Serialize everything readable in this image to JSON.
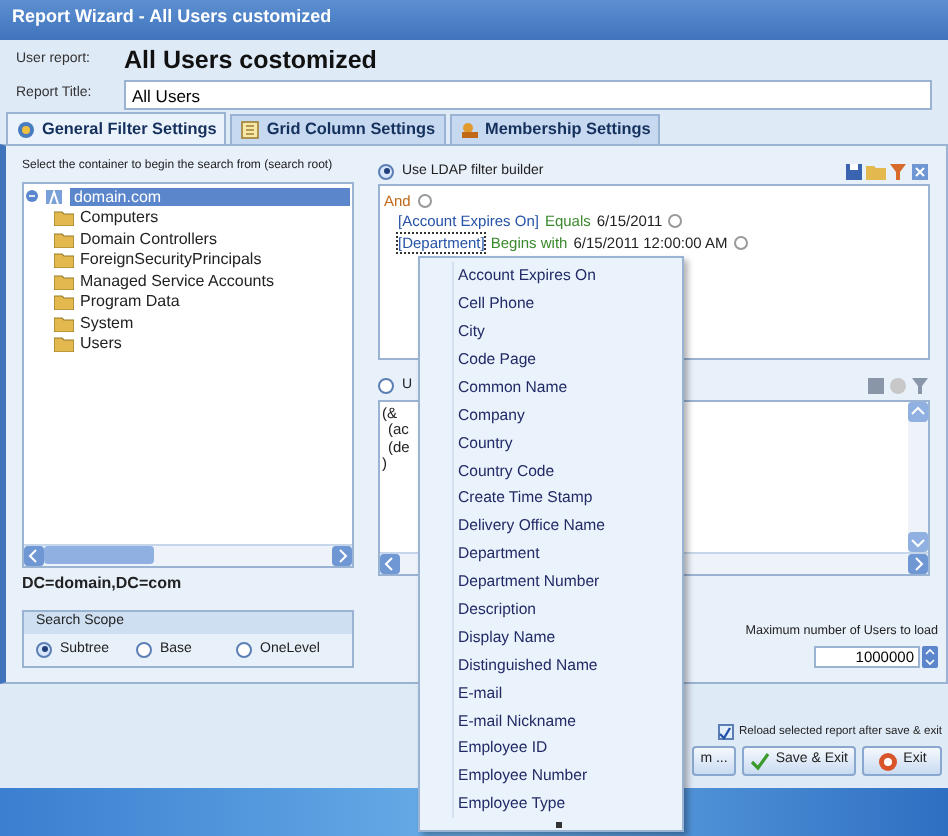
{
  "window": {
    "title": "Report Wizard - All Users customized"
  },
  "report": {
    "user_report_label": "User report:",
    "user_report": "All Users costomized",
    "title_label": "Report Title:",
    "title_value": "All Users"
  },
  "tabs": [
    {
      "label": "General Filter Settings",
      "selected": true,
      "kind": "general"
    },
    {
      "label": "Grid Column Settings",
      "selected": false,
      "kind": "grid"
    },
    {
      "label": "Membership Settings",
      "selected": false,
      "kind": "membership"
    }
  ],
  "search_root": {
    "label": "Select the container to begin the search from (search root)",
    "tree": [
      {
        "label": "domain.com",
        "selected": true,
        "expanded": true,
        "children": [
          {
            "label": "Computers",
            "selected": false
          },
          {
            "label": "Domain Controllers",
            "selected": false
          },
          {
            "label": "ForeignSecurityPrincipals",
            "selected": false
          },
          {
            "label": "Managed Service Accounts",
            "selected": false
          },
          {
            "label": "Program Data",
            "selected": false
          },
          {
            "label": "System",
            "selected": false
          },
          {
            "label": "Users",
            "selected": false
          }
        ]
      }
    ],
    "path": "DC=domain,DC=com"
  },
  "search_scope": {
    "title": "Search Scope",
    "options": [
      {
        "label": "Subtree",
        "selected": true
      },
      {
        "label": "Base",
        "selected": false
      },
      {
        "label": "OneLevel",
        "selected": false
      }
    ]
  },
  "filter_modes": [
    {
      "label": "Use LDAP filter builder",
      "selected": true
    },
    {
      "label": "U",
      "selected": false
    }
  ],
  "filter_builder": {
    "operator": "And",
    "conditions": [
      {
        "field": "[Account Expires On]",
        "operator": "Equals",
        "value": "6/15/2011",
        "focused": false
      },
      {
        "field": "[Department]",
        "operator": "Begins with",
        "value": "6/15/2011 12:00:00 AM",
        "focused": true
      }
    ]
  },
  "ldap_text": [
    "(&",
    "(ac",
    "(de",
    ")"
  ],
  "max_users": {
    "label": "Maximum number of Users to load",
    "value": "1000000"
  },
  "reload": {
    "label": "Reload selected report after save & exit",
    "checked": true
  },
  "buttons": [
    {
      "label": "m ...",
      "kind": "plain"
    },
    {
      "label": "Save & Exit",
      "kind": "save"
    },
    {
      "label": "Exit",
      "kind": "exit"
    }
  ],
  "field_menu": {
    "items": [
      "Account Expires On",
      "Cell Phone",
      "City",
      "Code Page",
      "Common Name",
      "Company",
      "Country",
      "Country Code",
      "Create Time Stamp",
      "Delivery Office Name",
      "Department",
      "Department Number",
      "Description",
      "Display Name",
      "Distinguished Name",
      "E-mail",
      "E-mail Nickname",
      "Employee ID",
      "Employee Number",
      "Employee Type"
    ]
  }
}
